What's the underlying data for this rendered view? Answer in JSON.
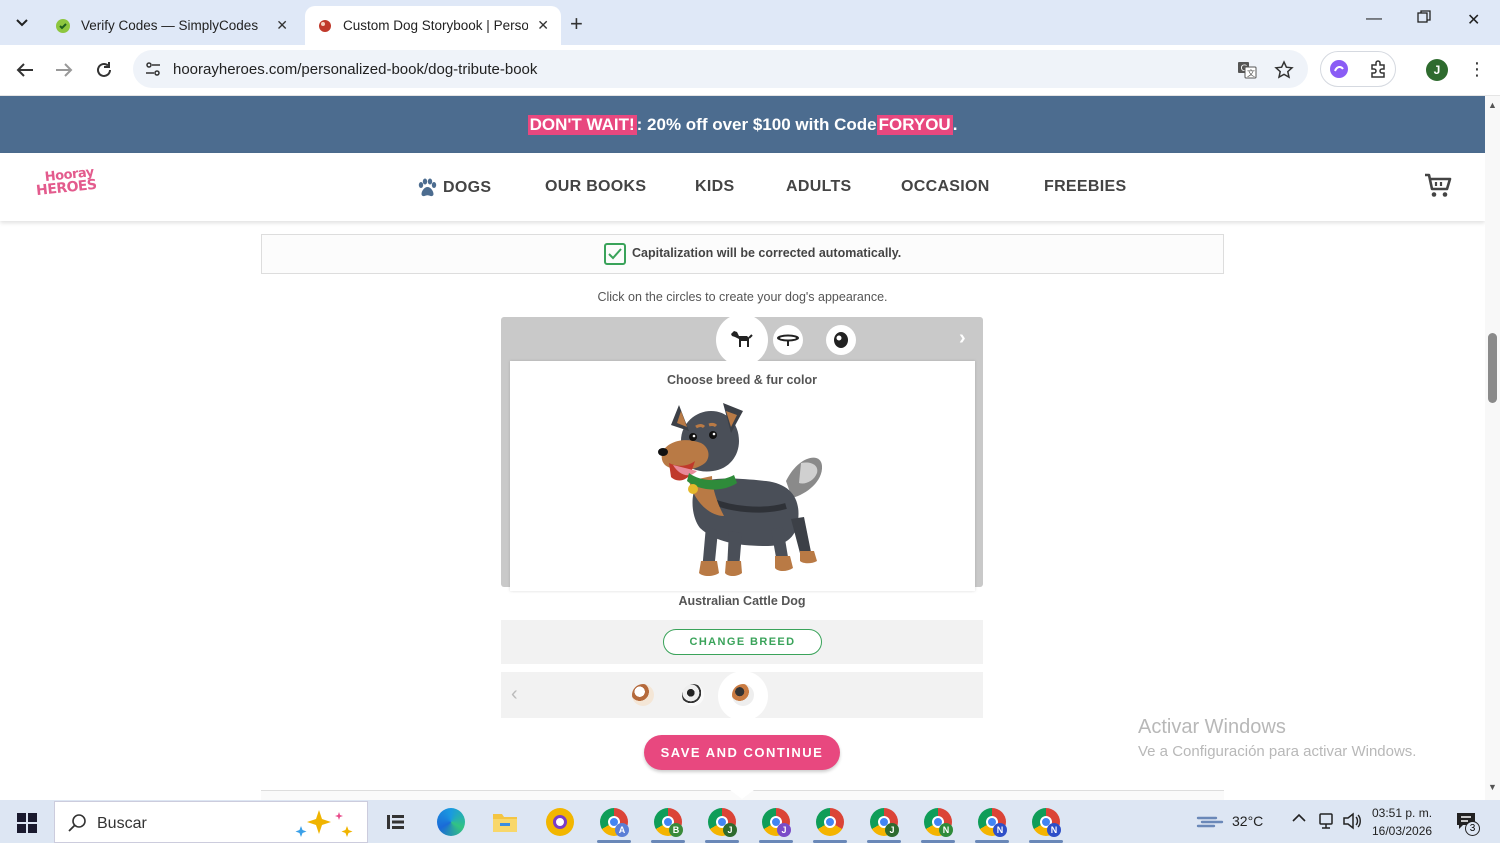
{
  "browser": {
    "tabs": [
      {
        "title": "Verify Codes — SimplyCodes",
        "active": false
      },
      {
        "title": "Custom Dog Storybook | Personalized",
        "active": true
      }
    ],
    "url": "hoorayheroes.com/personalized-book/dog-tribute-book",
    "profile_initial": "J"
  },
  "promo": {
    "part1": "DON'T WAIT!",
    "part2": ": 20% off over $100 with Code ",
    "code": "FORYOU",
    "part3": "."
  },
  "site": {
    "logo_line1": "Hooray",
    "logo_line2": "HEROES",
    "nav": [
      "DOGS",
      "OUR BOOKS",
      "KIDS",
      "ADULTS",
      "OCCASION",
      "FREEBIES"
    ]
  },
  "form": {
    "capitalization_note": "Capitalization will be corrected automatically.",
    "instruction": "Click on the circles to create your dog's appearance.",
    "step_label": "Choose breed & fur color",
    "breed": "Australian Cattle Dog",
    "change_breed_label": "CHANGE BREED",
    "save_label": "SAVE AND CONTINUE"
  },
  "colors": {
    "accent_pink": "#e8487f",
    "promo_bg": "#4c6c8f",
    "green": "#3aa35a"
  },
  "watermark": {
    "line1": "Activar Windows",
    "line2": "Ve a Configuración para activar Windows."
  },
  "taskbar": {
    "search_placeholder": "Buscar",
    "temperature": "32°C",
    "time": "03:51 p. m.",
    "date": "16/03/2026",
    "notifications": "3",
    "chrome_profiles": [
      "A",
      "B",
      "J",
      "J",
      "",
      "J",
      "N",
      "N",
      "N"
    ]
  }
}
